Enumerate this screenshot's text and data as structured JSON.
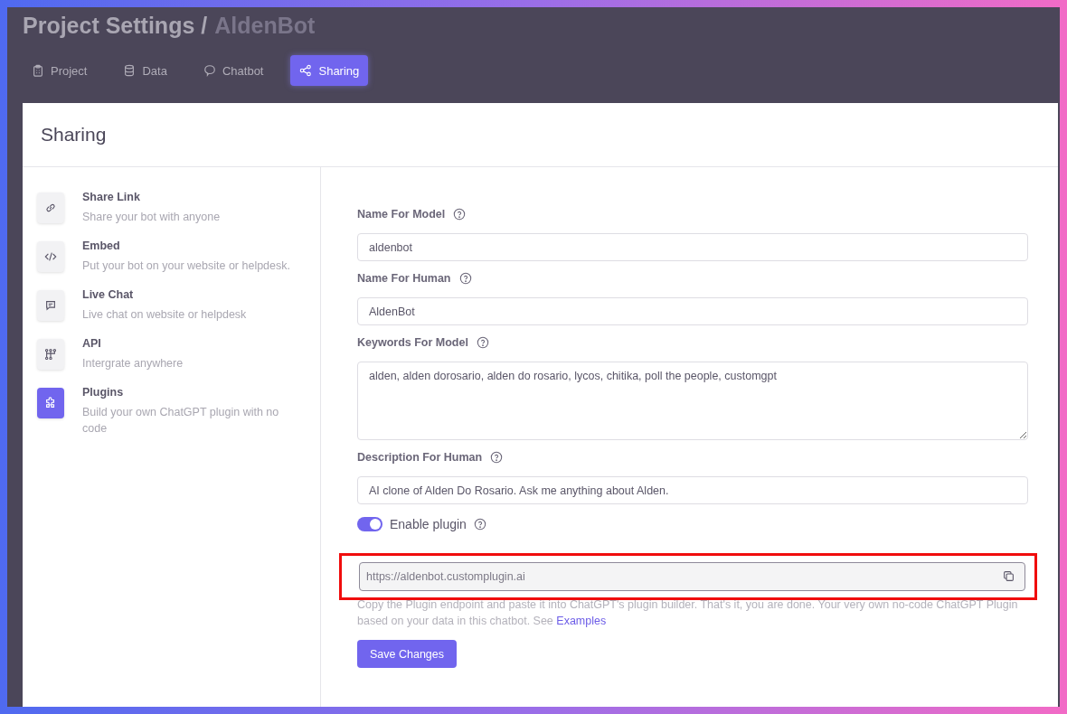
{
  "header": {
    "title": "Project Settings /",
    "project": "AldenBot"
  },
  "tabs": [
    {
      "label": "Project",
      "selected": false
    },
    {
      "label": "Data",
      "selected": false
    },
    {
      "label": "Chatbot",
      "selected": false
    },
    {
      "label": "Sharing",
      "selected": true
    }
  ],
  "card": {
    "title": "Sharing"
  },
  "sidebar": {
    "items": [
      {
        "title": "Share Link",
        "subtitle": "Share your bot with anyone",
        "selected": false
      },
      {
        "title": "Embed",
        "subtitle": "Put your bot on your website or helpdesk.",
        "selected": false
      },
      {
        "title": "Live Chat",
        "subtitle": "Live chat on website or helpdesk",
        "selected": false
      },
      {
        "title": "API",
        "subtitle": "Intergrate anywhere",
        "selected": false
      },
      {
        "title": "Plugins",
        "subtitle": "Build your own ChatGPT plugin with no code",
        "selected": true
      }
    ]
  },
  "form": {
    "fields": [
      {
        "label": "Name For Model",
        "kind": "input",
        "value": "aldenbot"
      },
      {
        "label": "Name For Human",
        "kind": "input",
        "value": "AldenBot"
      },
      {
        "label": "Keywords For Model",
        "kind": "textarea",
        "value": "alden, alden dorosario, alden do rosario, lycos, chitika, poll the people, customgpt"
      },
      {
        "label": "Description For Human",
        "kind": "input",
        "value": "AI clone of Alden Do Rosario. Ask me anything about Alden."
      }
    ],
    "toggle": {
      "label": "Enable plugin",
      "on": true
    },
    "endpoint": {
      "value": "https://aldenbot.customplugin.ai",
      "highlighted": true
    },
    "help": {
      "text": "Copy the Plugin endpoint and paste it into ChatGPT's plugin builder. That's it, you are done. Your very own no-code ChatGPT Plugin based on your data in this chatbot. See",
      "link": "Examples"
    },
    "save_button": "Save Changes"
  }
}
